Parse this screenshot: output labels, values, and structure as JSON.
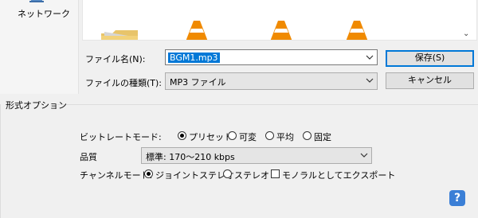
{
  "places": {
    "network_label": "ネットワーク"
  },
  "file_name": {
    "label": "ファイル名(N):",
    "value": "BGM1.mp3"
  },
  "file_type": {
    "label": "ファイルの種類(T):",
    "value": "MP3 ファイル"
  },
  "buttons": {
    "save": "保存(S)",
    "cancel": "キャンセル"
  },
  "format_options": {
    "title": "形式オプション",
    "bitrate_mode": {
      "label": "ビットレートモード:",
      "options": [
        "プリセット",
        "可変",
        "平均",
        "固定"
      ],
      "selected": "プリセット"
    },
    "quality": {
      "label": "品質",
      "value": "標準: 170～210 kbps"
    },
    "channel_mode": {
      "label": "チャンネルモード:",
      "options": [
        "ジョイントステレオ",
        "ステレオ"
      ],
      "selected": "ジョイントステレオ",
      "mono_label": "モノラルとしてエクスポート",
      "mono_checked": false
    }
  },
  "help": {
    "label": "?"
  },
  "colors": {
    "accent": "#0078d7",
    "help_bg": "#3b7fd6",
    "cone_orange": "#f08a00"
  }
}
